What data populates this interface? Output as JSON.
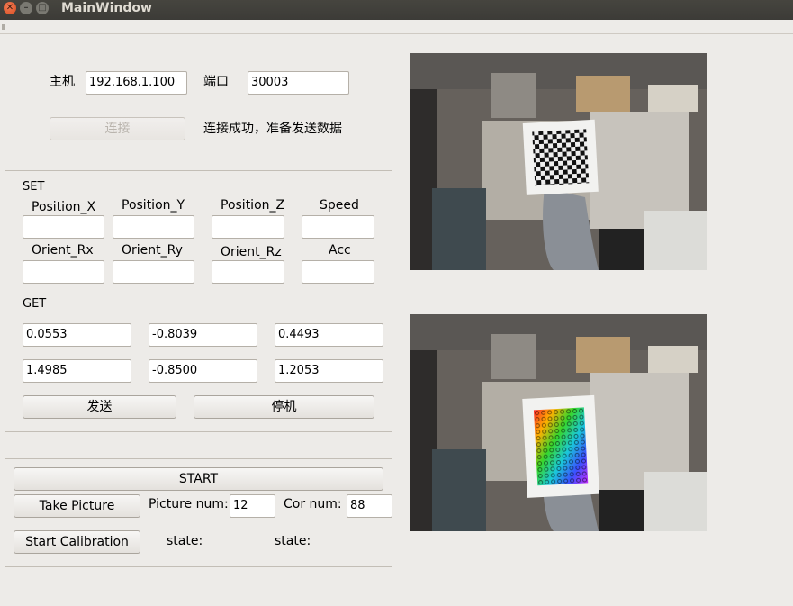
{
  "window": {
    "title": "MainWindow"
  },
  "connection": {
    "host_label": "主机",
    "host_value": "192.168.1.100",
    "port_label": "端口",
    "port_value": "30003",
    "connect_button": "连接",
    "status_text": "连接成功，准备发送数据"
  },
  "set": {
    "heading": "SET",
    "labels": [
      "Position_X",
      "Position_Y",
      "Position_Z",
      "Speed",
      "Orient_Rx",
      "Orient_Ry",
      "Orient_Rz",
      "Acc"
    ],
    "values": [
      "",
      "",
      "",
      "",
      "",
      "",
      "",
      ""
    ]
  },
  "get": {
    "heading": "GET",
    "values": [
      "0.0553",
      "-0.8039",
      "0.4493",
      "1.4985",
      "-0.8500",
      "1.2053"
    ]
  },
  "actions": {
    "send_button": "发送",
    "stop_button": "停机"
  },
  "calibration": {
    "start_button": "START",
    "take_picture_button": "Take Picture",
    "picture_num_label": "Picture num:",
    "picture_num_value": "12",
    "cor_num_label": "Cor num:",
    "cor_num_value": "88",
    "start_calibration_button": "Start  Calibration",
    "state_label_1": "state:",
    "state_label_2": "state:"
  },
  "colors": {
    "titlebar": "#3c3b37",
    "window_bg": "#edebe8",
    "close_button": "#e95420"
  }
}
